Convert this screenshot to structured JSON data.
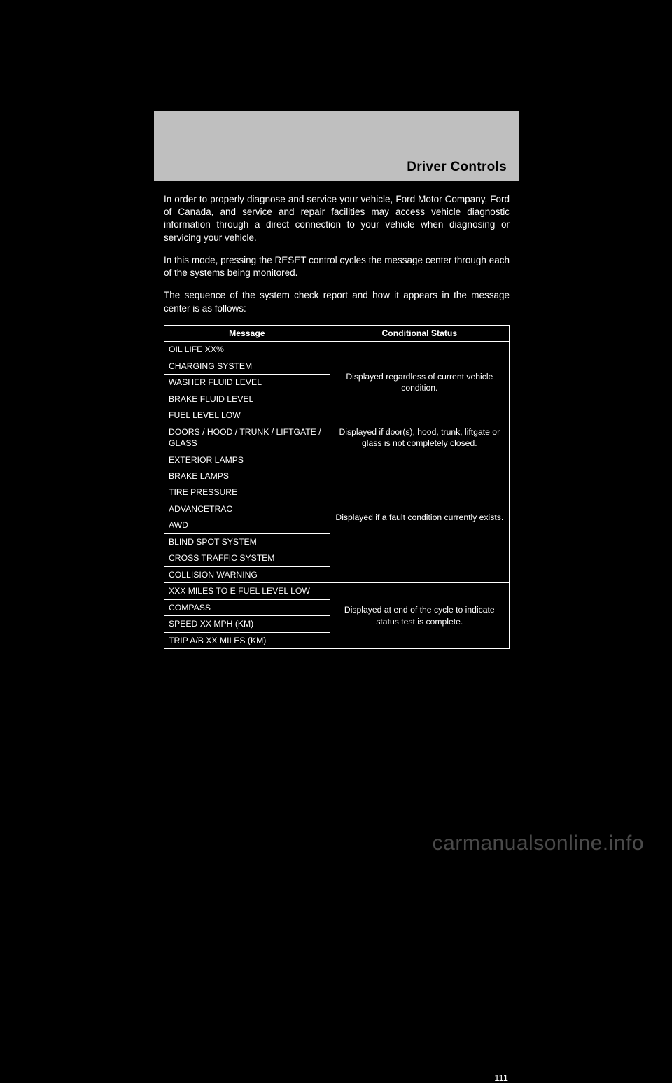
{
  "header": {
    "title": "Driver Controls"
  },
  "para1": "In order to properly diagnose and service your vehicle, Ford Motor Company, Ford of Canada, and service and repair facilities may access vehicle diagnostic information through a direct connection to your vehicle when diagnosing or servicing your vehicle.",
  "para2": "In this mode, pressing the RESET control cycles the message center through each of the systems being monitored.",
  "para3": "The sequence of the system check report and how it appears in the message center is as follows:",
  "table": {
    "headers": [
      "Message",
      "Conditional Status"
    ],
    "groups": [
      {
        "rows": [
          "OIL LIFE XX%",
          "CHARGING SYSTEM",
          "WASHER FLUID LEVEL",
          "BRAKE FLUID LEVEL",
          "FUEL LEVEL LOW"
        ],
        "status": "Displayed regardless of current vehicle condition."
      },
      {
        "rows": [
          "DOORS / HOOD / TRUNK / LIFTGATE / GLASS"
        ],
        "status": "Displayed if door(s), hood, trunk, liftgate or glass is not completely closed."
      },
      {
        "rows": [
          "EXTERIOR LAMPS",
          "BRAKE LAMPS",
          "TIRE PRESSURE",
          "ADVANCETRAC",
          "AWD",
          "BLIND SPOT SYSTEM",
          "CROSS TRAFFIC SYSTEM",
          "COLLISION WARNING"
        ],
        "status": "Displayed if a fault condition currently exists."
      },
      {
        "rows": [
          "XXX MILES TO E FUEL LEVEL LOW",
          "COMPASS",
          "SPEED XX MPH (KM)",
          "TRIP A/B XX MILES (KM)"
        ],
        "status": "Displayed at end of the cycle to indicate status test is complete."
      }
    ]
  },
  "pageNum": "111",
  "watermark": "carmanualsonline.info"
}
